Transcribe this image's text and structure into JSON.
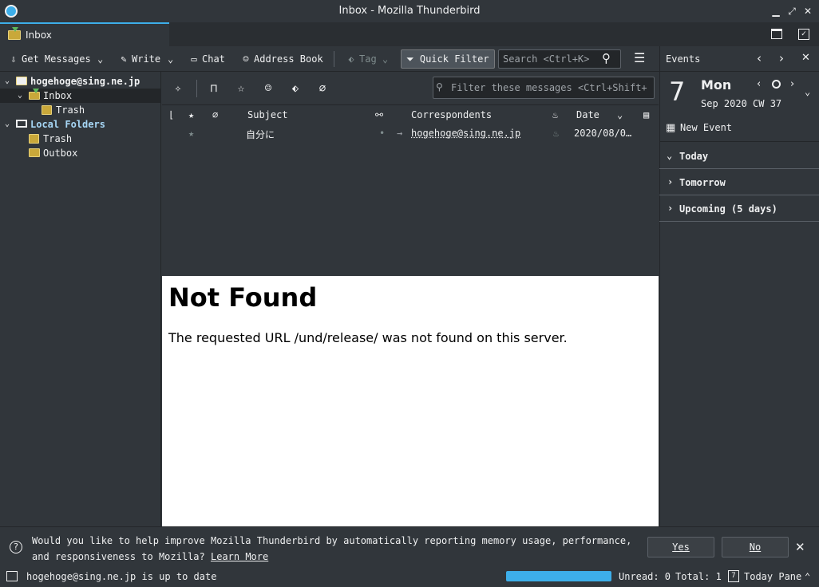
{
  "window": {
    "title": "Inbox - Mozilla Thunderbird"
  },
  "tabs": [
    {
      "label": "Inbox"
    }
  ],
  "toolbar": {
    "get_messages": "Get Messages",
    "write": "Write",
    "chat": "Chat",
    "address_book": "Address Book",
    "tag": "Tag",
    "quick_filter": "Quick Filter",
    "search_placeholder": "Search <Ctrl+K>"
  },
  "folders": {
    "account1": "hogehoge@sing.ne.jp",
    "inbox": "Inbox",
    "inbox_trash": "Trash",
    "local_folders": "Local Folders",
    "local_trash": "Trash",
    "outbox": "Outbox"
  },
  "quick_filter_bar": {
    "filter_placeholder": "Filter these messages <Ctrl+Shift+"
  },
  "thread_columns": {
    "subject": "Subject",
    "correspondents": "Correspondents",
    "date": "Date"
  },
  "messages": [
    {
      "subject": "自分に",
      "correspondent": "hogehoge@sing.ne.jp",
      "date": "2020/08/0…"
    }
  ],
  "message_pane": {
    "heading": "Not Found",
    "body": "The requested URL /und/release/ was not found on this server."
  },
  "today_pane": {
    "header": "Events",
    "day_number": "7",
    "weekday": "Mon",
    "month_line": "Sep 2020 CW 37",
    "new_event": "New Event",
    "sections": [
      "Today",
      "Tomorrow",
      "Upcoming (5 days)"
    ]
  },
  "notification": {
    "text": "Would you like to help improve Mozilla Thunderbird by automatically reporting memory usage, performance, and responsiveness to Mozilla?",
    "learn_more": "Learn More",
    "yes": "Yes",
    "no": "No"
  },
  "status": {
    "message": "hogehoge@sing.ne.jp is up to date",
    "progress_percent": 100,
    "unread": "Unread: 0",
    "total": "Total: 1",
    "today_pane_label": "Today Pane"
  },
  "colors": {
    "accent": "#3daee9",
    "background": "#31363b",
    "dark": "#232629"
  }
}
